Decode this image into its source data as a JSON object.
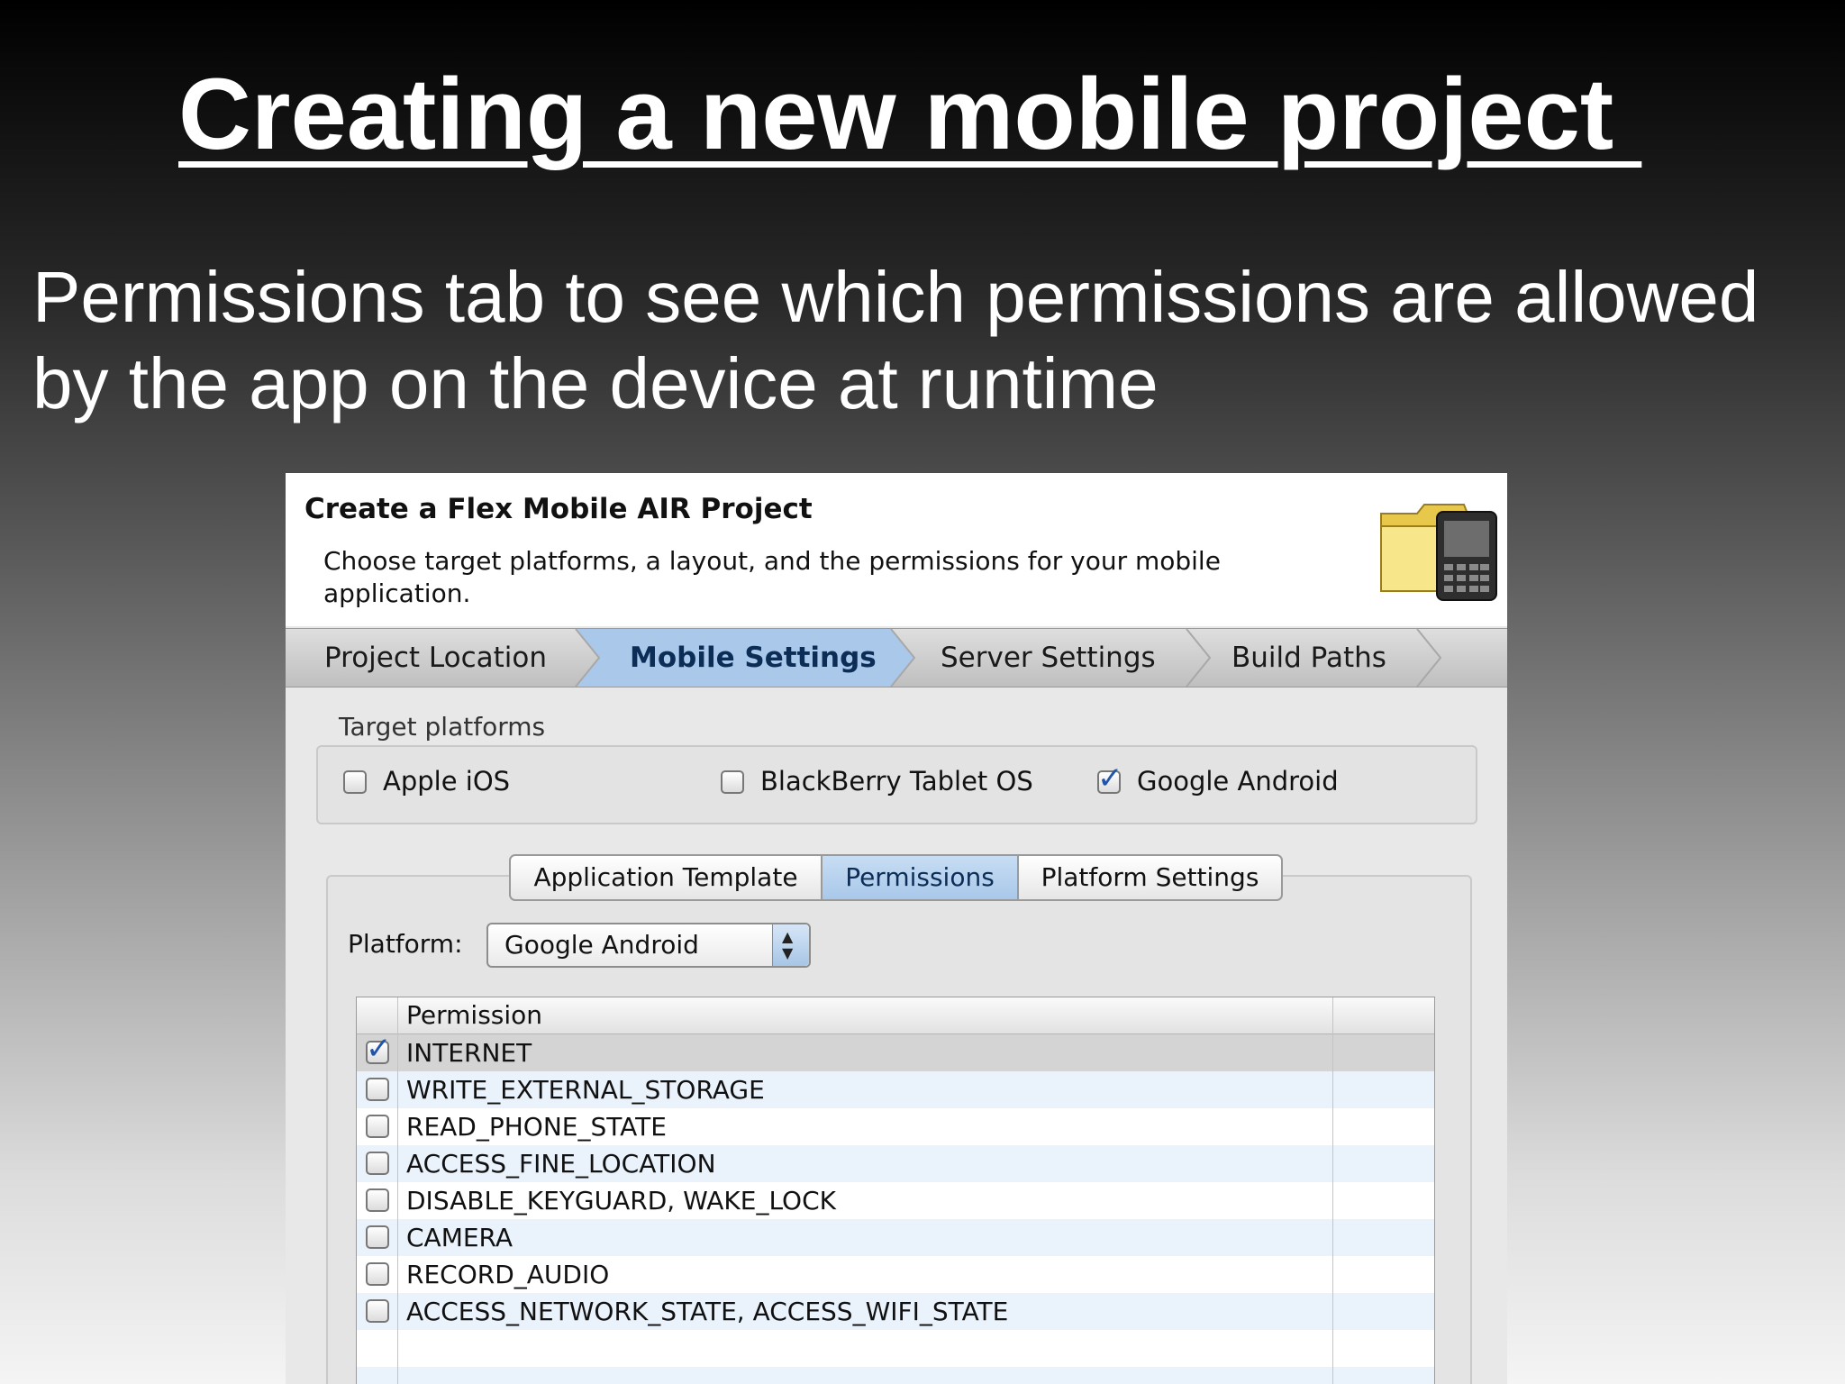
{
  "slide": {
    "title": "Creating a new mobile project ",
    "body": "Permissions tab to see which permissions are allowed by the app on the device at runtime"
  },
  "dialog": {
    "title": "Create a Flex Mobile AIR Project",
    "description": "Choose target platforms, a layout, and the permissions for your mobile application.",
    "header_icon": "folder-with-phone-icon",
    "wizard_steps": [
      {
        "label": "Project Location",
        "active": false
      },
      {
        "label": "Mobile Settings",
        "active": true
      },
      {
        "label": "Server Settings",
        "active": false
      },
      {
        "label": "Build Paths",
        "active": false
      }
    ],
    "target_platforms": {
      "label": "Target platforms",
      "options": [
        {
          "label": "Apple iOS",
          "checked": false
        },
        {
          "label": "BlackBerry Tablet OS",
          "checked": false
        },
        {
          "label": "Google Android",
          "checked": true
        }
      ]
    },
    "tabs": [
      {
        "label": "Application Template",
        "active": false
      },
      {
        "label": "Permissions",
        "active": true
      },
      {
        "label": "Platform Settings",
        "active": false
      }
    ],
    "platform": {
      "label": "Platform:",
      "selected": "Google Android"
    },
    "permissions_table": {
      "column_header": "Permission",
      "rows": [
        {
          "label": "INTERNET",
          "checked": true
        },
        {
          "label": "WRITE_EXTERNAL_STORAGE",
          "checked": false
        },
        {
          "label": "READ_PHONE_STATE",
          "checked": false
        },
        {
          "label": "ACCESS_FINE_LOCATION",
          "checked": false
        },
        {
          "label": "DISABLE_KEYGUARD, WAKE_LOCK",
          "checked": false
        },
        {
          "label": "CAMERA",
          "checked": false
        },
        {
          "label": "RECORD_AUDIO",
          "checked": false
        },
        {
          "label": "ACCESS_NETWORK_STATE, ACCESS_WIFI_STATE",
          "checked": false
        }
      ]
    }
  },
  "colors": {
    "active_tab": "#a9c8ea",
    "check_accent": "#2255aa",
    "row_alt": "#eaf2fc",
    "row_selected": "#d4d4d4"
  }
}
